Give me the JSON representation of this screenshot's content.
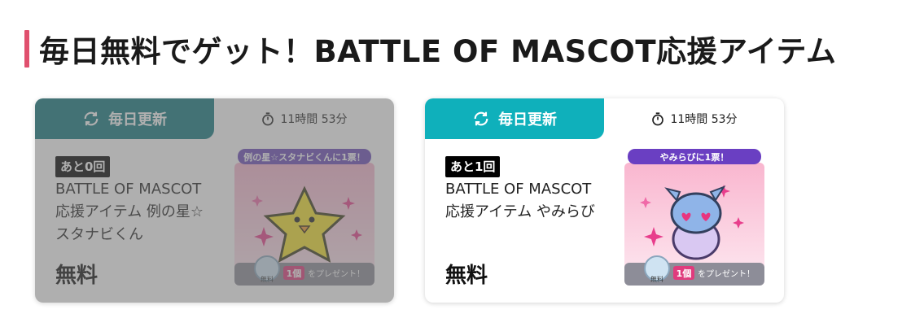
{
  "heading": {
    "title": "毎日無料でゲット！BATTLE OF MASCOT応援アイテム"
  },
  "colors": {
    "accent_bar": "#e0506e",
    "tab_teal": "#0fb0bb",
    "tab_teal_dim": "#11797f",
    "badge_bg": "#000000"
  },
  "cards": [
    {
      "tab_label": "毎日更新",
      "tab_icon": "refresh-icon",
      "timer_icon": "stopwatch-icon",
      "timer": "11時間 53分",
      "badge": "あと0回",
      "title": "BATTLE OF MASCOT 応援アイテム 例の星☆スタナビくん",
      "price": "無料",
      "thumb": {
        "banner": "例の星☆スタナビくんに1票！",
        "present_count": "1個",
        "present_text": "をプレゼント！",
        "coin_label": "無料"
      },
      "state": "exhausted"
    },
    {
      "tab_label": "毎日更新",
      "tab_icon": "refresh-icon",
      "timer_icon": "stopwatch-icon",
      "timer": "11時間 53分",
      "badge": "あと1回",
      "title": "BATTLE OF MASCOT 応援アイテム やみらび",
      "price": "無料",
      "thumb": {
        "banner": "やみらびに1票！",
        "present_count": "1個",
        "present_text": "をプレゼント！",
        "coin_label": "無料"
      },
      "state": "available"
    }
  ]
}
